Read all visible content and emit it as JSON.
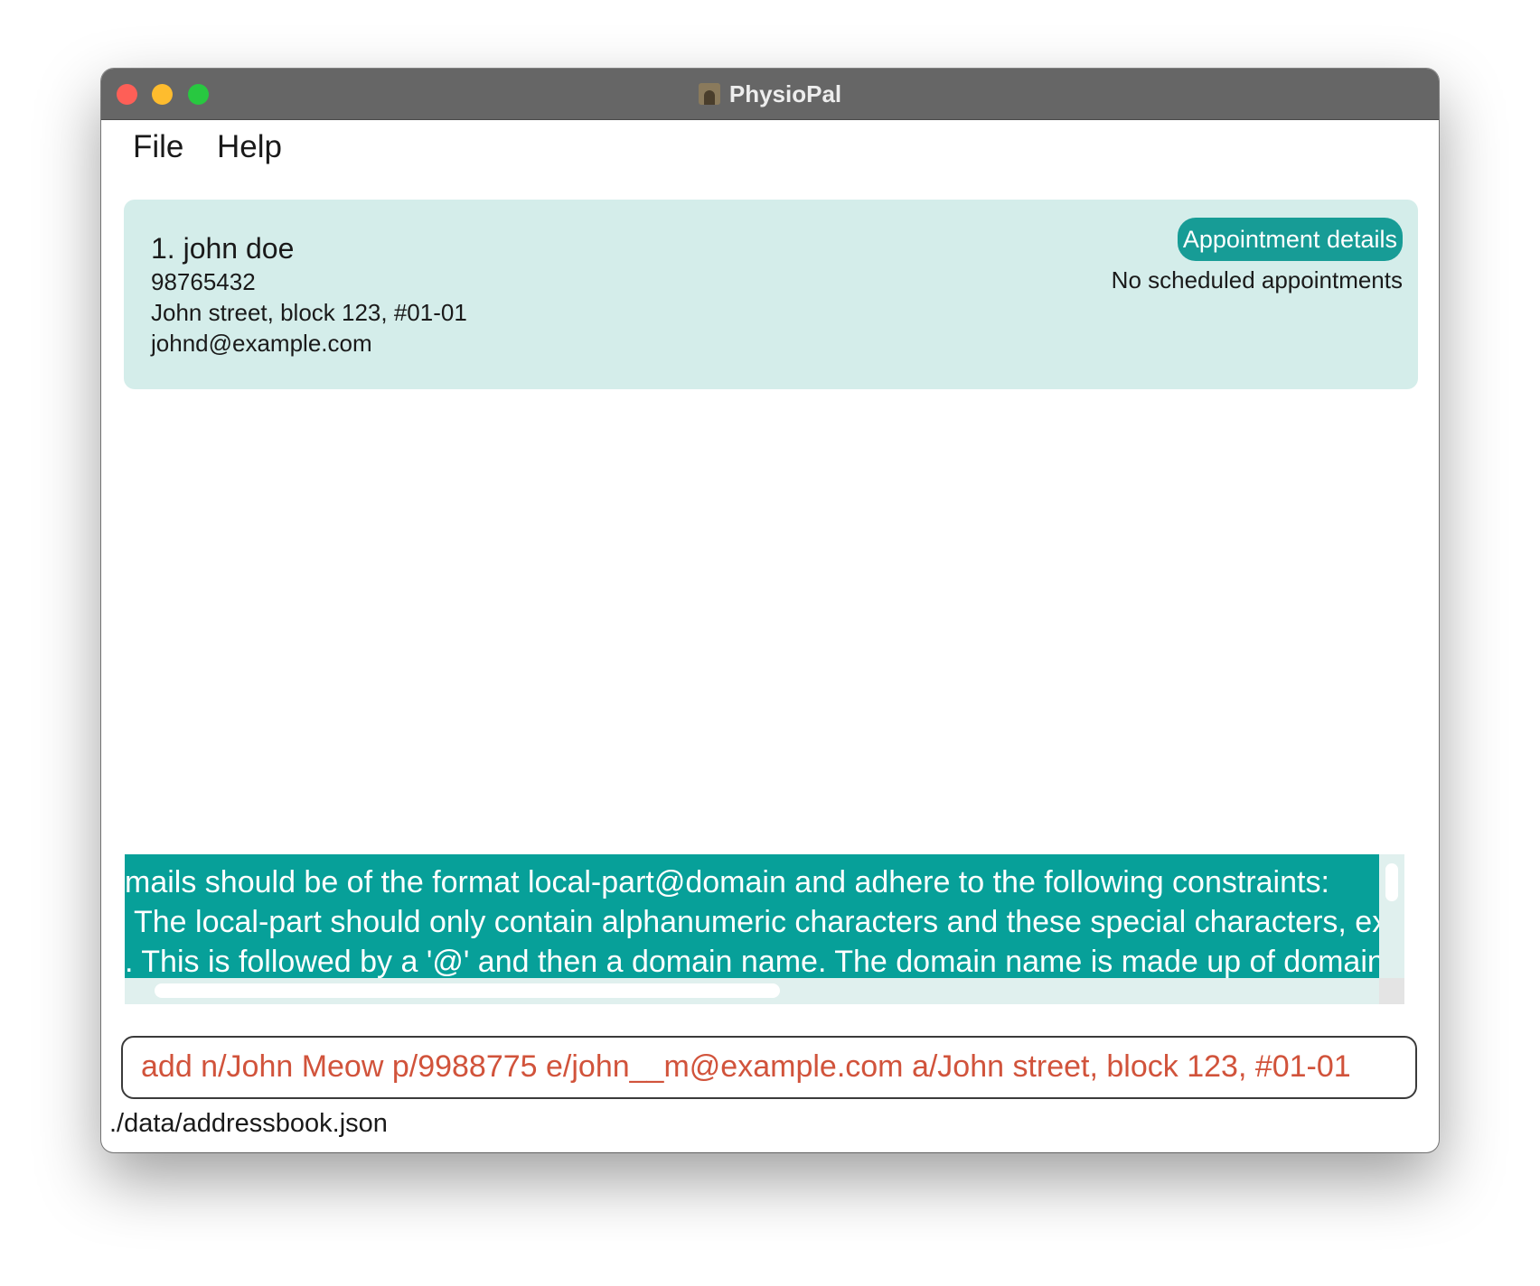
{
  "window": {
    "title": "PhysioPal"
  },
  "menu": {
    "file_label": "File",
    "help_label": "Help"
  },
  "person_card": {
    "name": "1. john doe",
    "phone": "98765432",
    "address": "John street, block 123, #01-01",
    "email": "johnd@example.com",
    "appointment_button_label": "Appointment details",
    "appointment_status": "No scheduled appointments"
  },
  "result_display": {
    "lines": [
      "mails should be of the format local-part@domain and adhere to the following constraints:",
      "The local-part should only contain alphanumeric characters and these special characters, exclud",
      ". This is followed by a '@' and then a domain name. The domain name is made up of domain labels"
    ]
  },
  "command_box": {
    "value": "add n/John Meow p/9988775 e/john__m@example.com a/John street, block 123, #01-01"
  },
  "status_bar": {
    "file_path": "./data/addressbook.json"
  },
  "colors": {
    "titlebar": "#666666",
    "card_background": "#d4edea",
    "accent": "#179c96",
    "result_background": "#07a099",
    "command_error_text": "#d1533b"
  },
  "icons": [
    "close-window-icon",
    "minimize-window-icon",
    "maximize-window-icon",
    "app-icon"
  ]
}
